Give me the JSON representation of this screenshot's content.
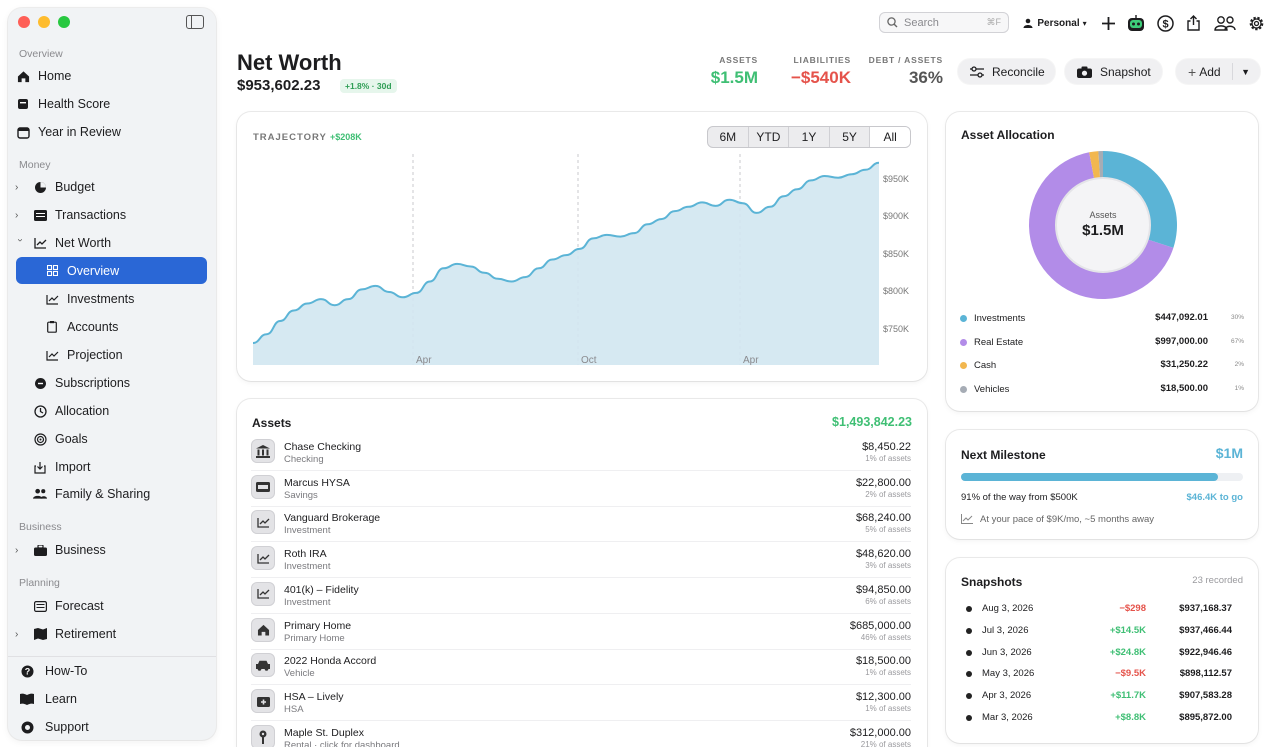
{
  "sidebar": {
    "sections": {
      "overview": "Overview",
      "money": "Money",
      "business": "Business",
      "planning": "Planning"
    },
    "items": [
      {
        "label": "Home",
        "icon": "house-icon"
      },
      {
        "label": "Health Score",
        "icon": "health-score-icon"
      },
      {
        "label": "Year in Review",
        "icon": "calendar-icon"
      },
      {
        "label": "Budget",
        "icon": "pie-chart-icon"
      },
      {
        "label": "Transactions",
        "icon": "list-icon"
      },
      {
        "label": "Net Worth",
        "icon": "line-chart-icon"
      },
      {
        "label": "Overview",
        "icon": "grid-icon"
      },
      {
        "label": "Investments",
        "icon": "trend-icon"
      },
      {
        "label": "Accounts",
        "icon": "clipboard-icon"
      },
      {
        "label": "Projection",
        "icon": "projection-icon"
      },
      {
        "label": "Subscriptions",
        "icon": "subscriptions-icon"
      },
      {
        "label": "Allocation",
        "icon": "clock-icon"
      },
      {
        "label": "Goals",
        "icon": "target-icon"
      },
      {
        "label": "Import",
        "icon": "import-icon"
      },
      {
        "label": "Family & Sharing",
        "icon": "people-icon"
      },
      {
        "label": "Business",
        "icon": "briefcase-icon"
      },
      {
        "label": "Forecast",
        "icon": "forecast-icon"
      },
      {
        "label": "Retirement",
        "icon": "map-icon"
      }
    ],
    "footer": [
      {
        "label": "How-To",
        "icon": "question-icon"
      },
      {
        "label": "Learn",
        "icon": "book-icon"
      },
      {
        "label": "Support",
        "icon": "support-icon"
      }
    ]
  },
  "topbar": {
    "search_placeholder": "Search",
    "search_shortcut": "⌘F",
    "profile": "Personal"
  },
  "header": {
    "title": "Net Worth",
    "total": "$953,602.23",
    "change": "+1.8% · 30d",
    "assets_label": "ASSETS",
    "assets_value": "$1.5M",
    "liabilities_label": "LIABILITIES",
    "liabilities_value": "−$540K",
    "debt_label": "DEBT / ASSETS",
    "debt_value": "36%",
    "reconcile": "Reconcile",
    "snapshot": "Snapshot",
    "add": "Add"
  },
  "colors": {
    "accent": "#2a67d6",
    "green": "#3fbf74",
    "red": "#e5534b",
    "chart": "#5bb4d6",
    "realestate": "#b28ce8",
    "cash": "#f2b74f",
    "vehicles": "#a6acb5"
  },
  "trajectory": {
    "label": "TRAJECTORY",
    "delta": "+$208K",
    "ranges": [
      "6M",
      "YTD",
      "1Y",
      "5Y",
      "All"
    ],
    "selected": "All"
  },
  "chart_data": {
    "type": "area",
    "title": "TRAJECTORY",
    "x_labels": [
      "Apr",
      "Oct",
      "Apr"
    ],
    "y_ticks": [
      "$950K",
      "$900K",
      "$850K",
      "$800K",
      "$750K"
    ],
    "ylim": [
      720000,
      960000
    ],
    "values": [
      745000,
      755000,
      770000,
      782000,
      790000,
      795000,
      788000,
      795000,
      806000,
      810000,
      803000,
      797000,
      802000,
      815000,
      830000,
      835000,
      832000,
      825000,
      818000,
      815000,
      820000,
      830000,
      840000,
      845000,
      852000,
      864000,
      868000,
      866000,
      870000,
      880000,
      886000,
      895000,
      900000,
      905000,
      901000,
      908000,
      904000,
      893000,
      900000,
      912000,
      920000,
      930000,
      935000,
      933000,
      937000,
      942000,
      950000
    ],
    "grid": "vertical dashed",
    "legend": "none"
  },
  "assets": {
    "title": "Assets",
    "total": "$1,493,842.23",
    "rows": [
      {
        "name": "Chase Checking",
        "sub": "Checking",
        "amount": "$8,450.22",
        "pct": "1% of assets",
        "icon": "bank-icon"
      },
      {
        "name": "Marcus HYSA",
        "sub": "Savings",
        "amount": "$22,800.00",
        "pct": "2% of assets",
        "icon": "savings-icon"
      },
      {
        "name": "Vanguard Brokerage",
        "sub": "Investment",
        "amount": "$68,240.00",
        "pct": "5% of assets",
        "icon": "trend-icon"
      },
      {
        "name": "Roth IRA",
        "sub": "Investment",
        "amount": "$48,620.00",
        "pct": "3% of assets",
        "icon": "trend-icon"
      },
      {
        "name": "401(k) – Fidelity",
        "sub": "Investment",
        "amount": "$94,850.00",
        "pct": "6% of assets",
        "icon": "trend-icon"
      },
      {
        "name": "Primary Home",
        "sub": "Primary Home",
        "amount": "$685,000.00",
        "pct": "46% of assets",
        "icon": "house-icon"
      },
      {
        "name": "2022 Honda Accord",
        "sub": "Vehicle",
        "amount": "$18,500.00",
        "pct": "1% of assets",
        "icon": "car-icon"
      },
      {
        "name": "HSA – Lively",
        "sub": "HSA",
        "amount": "$12,300.00",
        "pct": "1% of assets",
        "icon": "medical-icon"
      },
      {
        "name": "Maple St. Duplex",
        "sub": "Rental · click for dashboard",
        "amount": "$312,000.00",
        "pct": "21% of assets",
        "icon": "key-icon"
      }
    ]
  },
  "allocation": {
    "title": "Asset Allocation",
    "center_label": "Assets",
    "center_value": "$1.5M",
    "items": [
      {
        "name": "Investments",
        "value": "$447,092.01",
        "pct": "30%",
        "share": 0.3,
        "color": "#5bb4d6"
      },
      {
        "name": "Real Estate",
        "value": "$997,000.00",
        "pct": "67%",
        "share": 0.67,
        "color": "#b28ce8"
      },
      {
        "name": "Cash",
        "value": "$31,250.22",
        "pct": "2%",
        "share": 0.02,
        "color": "#f2b74f"
      },
      {
        "name": "Vehicles",
        "value": "$18,500.00",
        "pct": "1%",
        "share": 0.01,
        "color": "#a6acb5"
      }
    ]
  },
  "milestone": {
    "title": "Next Milestone",
    "target": "$1M",
    "progress": 0.91,
    "progress_text": "91% of the way from $500K",
    "to_go": "$46.4K to go",
    "pace": "At your pace of $9K/mo, ~5 months away"
  },
  "snapshots": {
    "title": "Snapshots",
    "count": "23 recorded",
    "rows": [
      {
        "date": "Aug 3, 2026",
        "change": "−$298",
        "value": "$937,168.37",
        "neg": true
      },
      {
        "date": "Jul 3, 2026",
        "change": "+$14.5K",
        "value": "$937,466.44",
        "neg": false
      },
      {
        "date": "Jun 3, 2026",
        "change": "+$24.8K",
        "value": "$922,946.46",
        "neg": false
      },
      {
        "date": "May 3, 2026",
        "change": "−$9.5K",
        "value": "$898,112.57",
        "neg": true
      },
      {
        "date": "Apr 3, 2026",
        "change": "+$11.7K",
        "value": "$907,583.28",
        "neg": false
      },
      {
        "date": "Mar 3, 2026",
        "change": "+$8.8K",
        "value": "$895,872.00",
        "neg": false
      }
    ]
  }
}
